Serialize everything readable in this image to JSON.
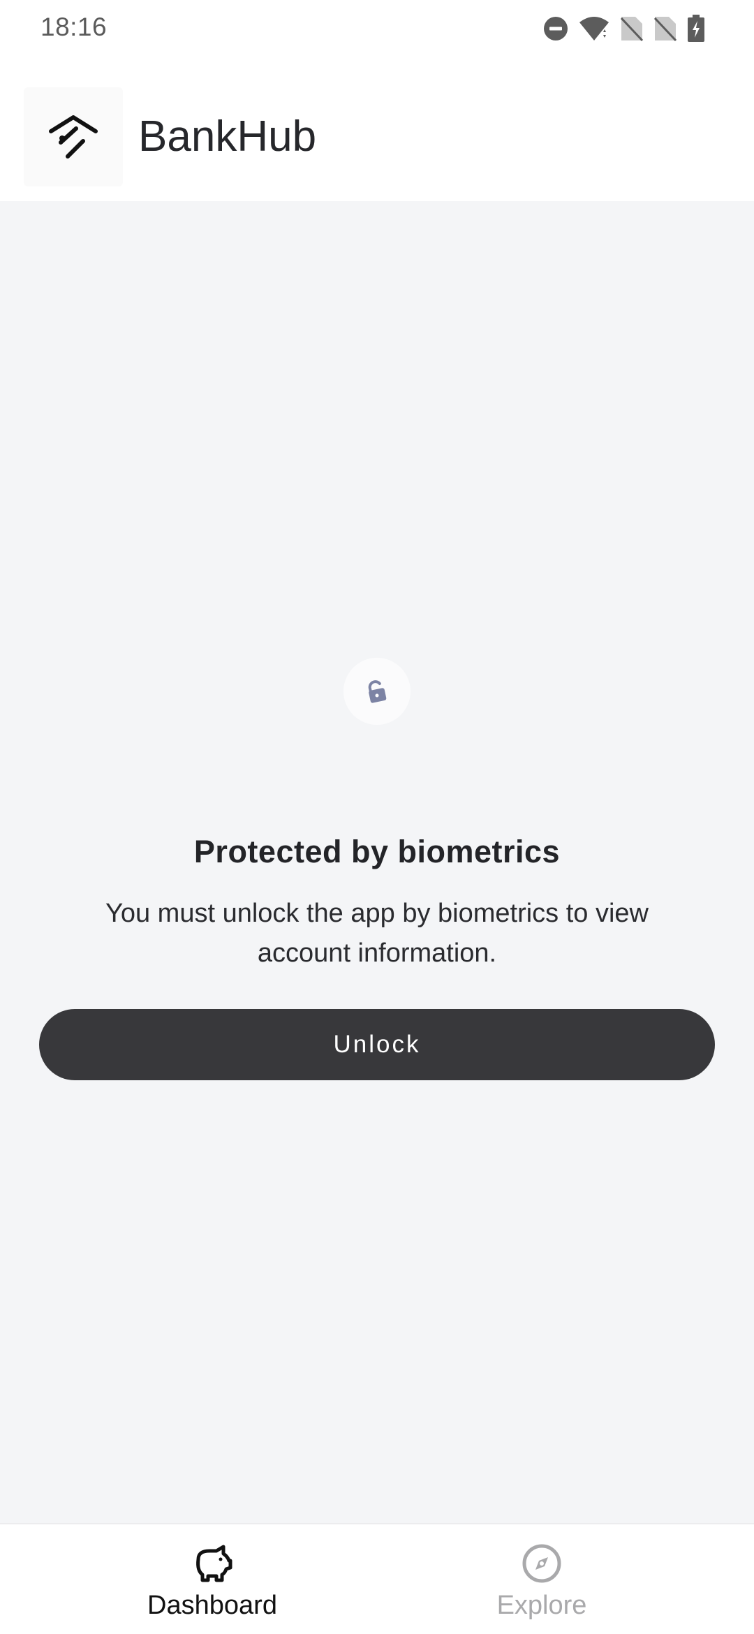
{
  "status_bar": {
    "time": "18:16",
    "icons": [
      "do-not-disturb-icon",
      "wifi-icon",
      "no-sim-icon",
      "no-sim-icon",
      "battery-charging-icon"
    ]
  },
  "app_bar": {
    "title": "BankHub",
    "logo_icon": "bankhub-logo-icon"
  },
  "lock_screen": {
    "icon": "lock-open-icon",
    "heading": "Protected by biometrics",
    "description": "You must unlock the app by biometrics to view account information.",
    "unlock_label": "Unlock"
  },
  "bottom_nav": {
    "items": [
      {
        "label": "Dashboard",
        "icon": "piggy-bank-icon",
        "active": true
      },
      {
        "label": "Explore",
        "icon": "compass-icon",
        "active": false
      }
    ]
  },
  "colors": {
    "background": "#f4f5f7",
    "button": "#38383b",
    "lock_icon": "#7c83a4",
    "inactive_nav": "#a9a9ab"
  }
}
